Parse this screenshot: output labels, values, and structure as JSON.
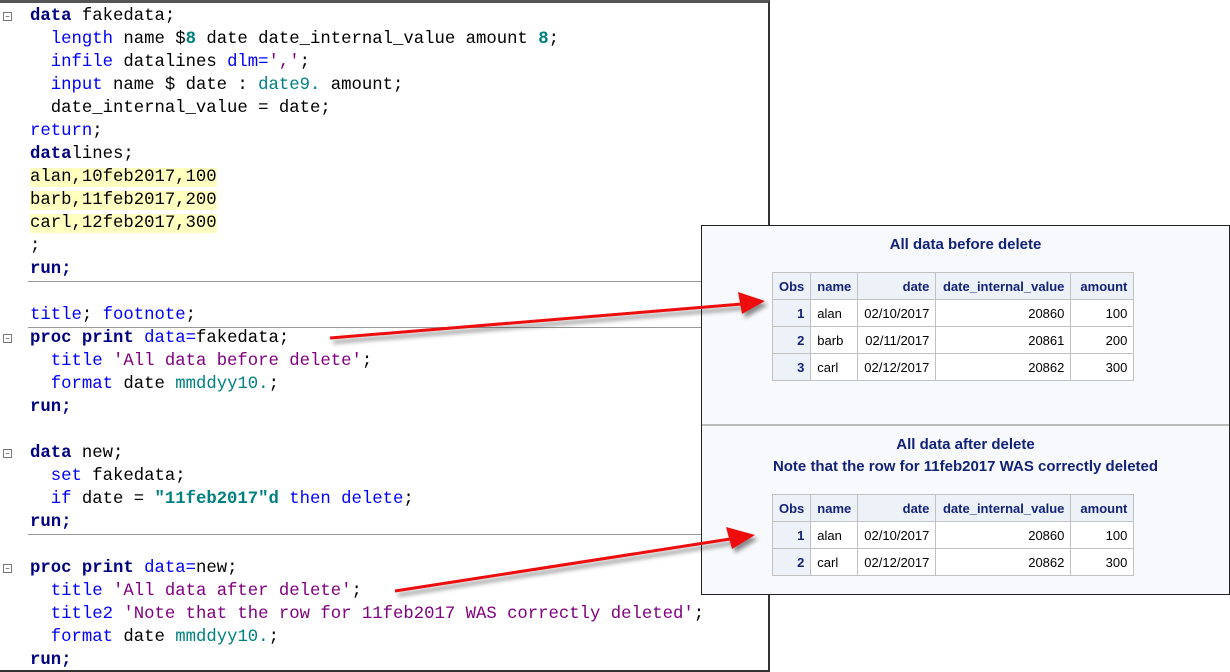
{
  "code_lines": [
    "data fakedata;",
    "length name $8 date date_internal_value amount 8;",
    "infile datalines dlm=',';",
    "input name $ date : date9. amount;",
    "date_internal_value = date;",
    "return;",
    "datalines;",
    "alan,10feb2017,100",
    "barb,11feb2017,200",
    "carl,12feb2017,300",
    ";",
    "run;",
    "title; footnote;",
    "proc print data=fakedata;",
    "title 'All data before delete';",
    "format date mmddyy10.;",
    "run;",
    "data new;",
    "set fakedata;",
    "if date = \"11feb2017\"d then delete;",
    "run;",
    "proc print data=new;",
    "title 'All data after delete';",
    "title2 'Note that the row for 11feb2017 WAS correctly deleted';",
    "format date mmddyy10.;",
    "run;"
  ],
  "output": {
    "columns": [
      "Obs",
      "name",
      "date",
      "date_internal_value",
      "amount"
    ],
    "before": {
      "title": "All data before delete",
      "rows": [
        [
          "1",
          "alan",
          "02/10/2017",
          "20860",
          "100"
        ],
        [
          "2",
          "barb",
          "02/11/2017",
          "20861",
          "200"
        ],
        [
          "3",
          "carl",
          "02/12/2017",
          "20862",
          "300"
        ]
      ]
    },
    "after": {
      "title": "All data after delete",
      "title2": "Note that the row for 11feb2017 WAS correctly deleted",
      "rows": [
        [
          "1",
          "alan",
          "02/10/2017",
          "20860",
          "100"
        ],
        [
          "2",
          "carl",
          "02/12/2017",
          "20862",
          "300"
        ]
      ]
    }
  },
  "colors": {
    "arrow": "#ee1111",
    "title": "#112277"
  }
}
